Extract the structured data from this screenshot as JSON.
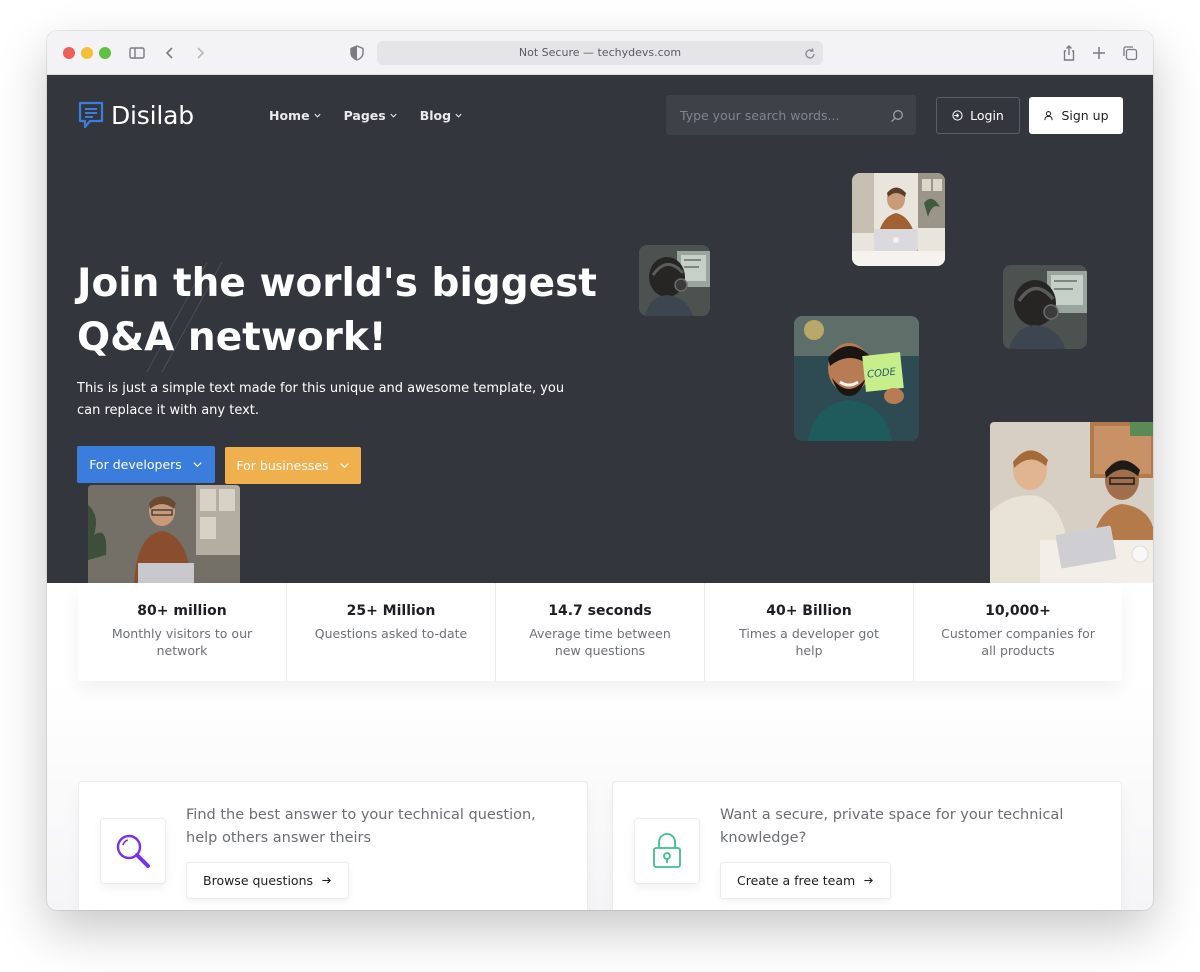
{
  "browser": {
    "url_text": "Not Secure — techydevs.com"
  },
  "site": {
    "logo_text": "Disilab",
    "nav": [
      {
        "label": "Home"
      },
      {
        "label": "Pages"
      },
      {
        "label": "Blog"
      }
    ],
    "search": {
      "placeholder": "Type your search words..."
    },
    "login_label": "Login",
    "signup_label": "Sign up"
  },
  "hero": {
    "title_line1": "Join the world's biggest",
    "title_line2": "Q&A network!",
    "text": "This is just a simple text made for this unique and awesome template, you can replace it with any text.",
    "btn_developers": "For developers",
    "btn_businesses": "For businesses",
    "code_note": "CODE"
  },
  "stats": [
    {
      "value": "80+ million",
      "label": "Monthly visitors to our network"
    },
    {
      "value": "25+ Million",
      "label": "Questions asked to-date"
    },
    {
      "value": "14.7 seconds",
      "label": "Average time between new questions"
    },
    {
      "value": "40+ Billion",
      "label": "Times a developer got help"
    },
    {
      "value": "10,000+",
      "label": "Customer companies for all products"
    }
  ],
  "cards": [
    {
      "text": "Find the best answer to your technical question, help others answer theirs",
      "button": "Browse questions",
      "icon": "magnifier-icon"
    },
    {
      "text": "Want a secure, private space for your technical knowledge?",
      "button": "Create a free team",
      "icon": "lock-icon"
    }
  ],
  "colors": {
    "hero_bg": "#33373d",
    "primary_blue": "#3b7ddd",
    "accent_orange": "#f0b04e",
    "icon_purple": "#7b2ff0",
    "icon_green": "#3cc08a"
  }
}
